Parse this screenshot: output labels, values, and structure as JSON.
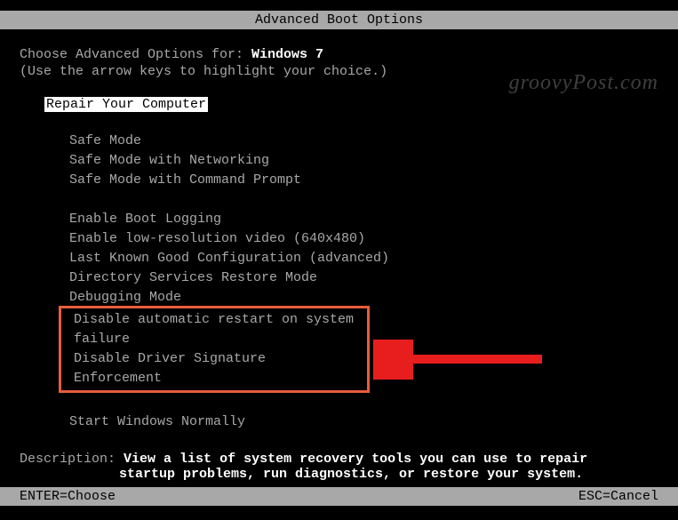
{
  "title": "Advanced Boot Options",
  "intro": {
    "prefix": "Choose Advanced Options for: ",
    "os": "Windows 7",
    "hint": "(Use the arrow keys to highlight your choice.)"
  },
  "selected": "Repair Your Computer",
  "groups": [
    {
      "items": [
        "Safe Mode",
        "Safe Mode with Networking",
        "Safe Mode with Command Prompt"
      ]
    },
    {
      "items": [
        "Enable Boot Logging",
        "Enable low-resolution video (640x480)",
        "Last Known Good Configuration (advanced)",
        "Directory Services Restore Mode",
        "Debugging Mode",
        "Disable automatic restart on system failure",
        "Disable Driver Signature Enforcement"
      ]
    },
    {
      "items": [
        "Start Windows Normally"
      ]
    }
  ],
  "description": {
    "label": "Description:",
    "line1": "View a list of system recovery tools you can use to repair",
    "line2": "startup problems, run diagnostics, or restore your system."
  },
  "footer": {
    "left": "ENTER=Choose",
    "right": "ESC=Cancel"
  },
  "watermark": "groovyPost.com"
}
